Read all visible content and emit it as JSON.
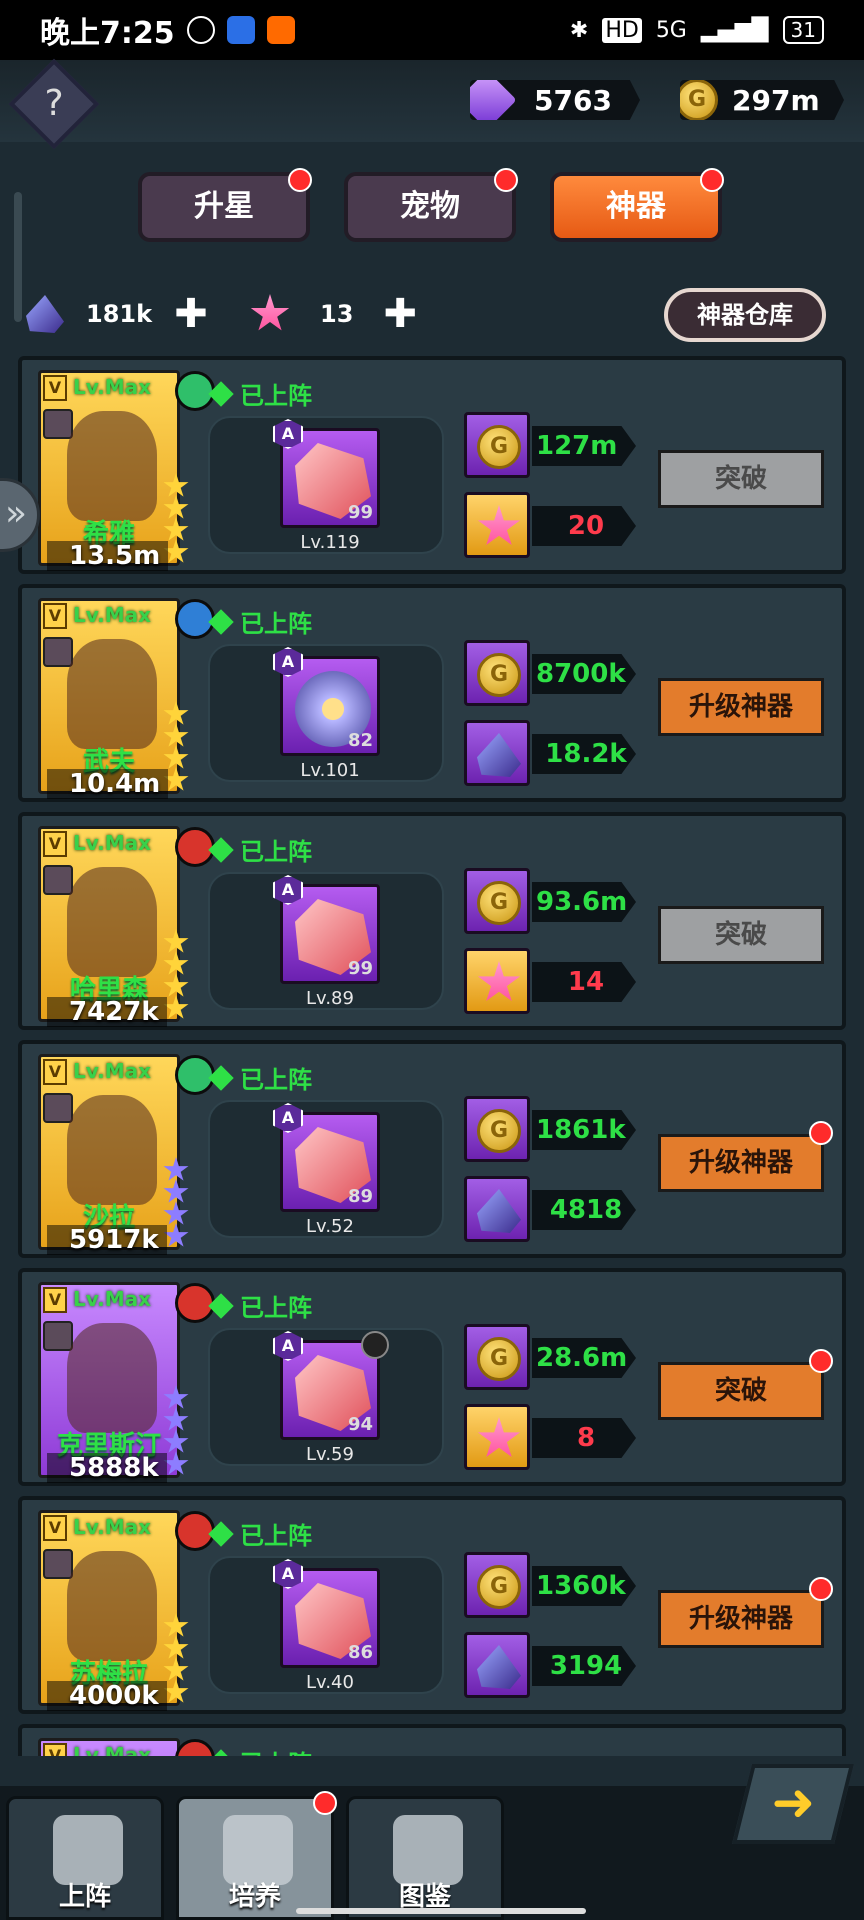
{
  "status_bar": {
    "time": "晚上7:25",
    "network": "5G",
    "battery": "31"
  },
  "header": {
    "help_icon": "question-diamond-icon",
    "gems": "5763",
    "gold": "297m"
  },
  "tabs": [
    {
      "label": "升星",
      "active": false,
      "dot": true
    },
    {
      "label": "宠物",
      "active": false,
      "dot": true
    },
    {
      "label": "神器",
      "active": true,
      "dot": true
    }
  ],
  "resources": {
    "shards": "181k",
    "stars": "13",
    "warehouse_label": "神器仓库"
  },
  "heroes": [
    {
      "name": "希雅",
      "level": "Lv.Max",
      "power": "13.5m",
      "status": "已上阵",
      "element": "wind",
      "artifact_level": "Lv.119",
      "artifact_count": "99",
      "cost1": "127m",
      "cost2": "20",
      "cost2_type": "star",
      "action": "突破",
      "action_style": "gray",
      "action_dot": false,
      "portrait": "gold"
    },
    {
      "name": "武夫",
      "level": "Lv.Max",
      "power": "10.4m",
      "status": "已上阵",
      "element": "water",
      "artifact_level": "Lv.101",
      "artifact_count": "82",
      "cost1": "8700k",
      "cost2": "18.2k",
      "cost2_type": "shard",
      "action": "升级神器",
      "action_style": "orange",
      "action_dot": false,
      "portrait": "gold"
    },
    {
      "name": "哈里森",
      "level": "Lv.Max",
      "power": "7427k",
      "status": "已上阵",
      "element": "fire",
      "artifact_level": "Lv.89",
      "artifact_count": "99",
      "cost1": "93.6m",
      "cost2": "14",
      "cost2_type": "star",
      "action": "突破",
      "action_style": "gray",
      "action_dot": false,
      "portrait": "gold"
    },
    {
      "name": "沙拉",
      "level": "Lv.Max",
      "power": "5917k",
      "status": "已上阵",
      "element": "wind",
      "artifact_level": "Lv.52",
      "artifact_count": "89",
      "cost1": "1861k",
      "cost2": "4818",
      "cost2_type": "shard",
      "action": "升级神器",
      "action_style": "orange",
      "action_dot": true,
      "portrait": "gold"
    },
    {
      "name": "克里斯汀",
      "level": "Lv.Max",
      "power": "5888k",
      "status": "已上阵",
      "element": "fire",
      "artifact_level": "Lv.59",
      "artifact_count": "94",
      "cost1": "28.6m",
      "cost2": "8",
      "cost2_type": "star",
      "action": "突破",
      "action_style": "orange",
      "action_dot": true,
      "portrait": "purple"
    },
    {
      "name": "苏梅拉",
      "level": "Lv.Max",
      "power": "4000k",
      "status": "已上阵",
      "element": "fire",
      "artifact_level": "Lv.40",
      "artifact_count": "86",
      "cost1": "1360k",
      "cost2": "3194",
      "cost2_type": "shard",
      "action": "升级神器",
      "action_style": "orange",
      "action_dot": true,
      "portrait": "gold"
    },
    {
      "name": "",
      "level": "Lv.Max",
      "power": "",
      "status": "已上阵",
      "element": "fire",
      "artifact_level": "",
      "artifact_count": "",
      "cost1": "",
      "cost2": "",
      "cost2_type": "shard",
      "action": "",
      "action_style": "orange",
      "action_dot": false,
      "portrait": "purple"
    }
  ],
  "bottom_nav": [
    {
      "label": "上阵",
      "icon": "knight-helmet-icon",
      "active": false,
      "dot": false
    },
    {
      "label": "培养",
      "icon": "star-growth-icon",
      "active": true,
      "dot": true
    },
    {
      "label": "图鉴",
      "icon": "codex-icon",
      "active": false,
      "dot": false
    }
  ],
  "colors": {
    "accent_orange": "#e37c2c",
    "green_text": "#2ee046",
    "red_text": "#ff3b4c"
  }
}
